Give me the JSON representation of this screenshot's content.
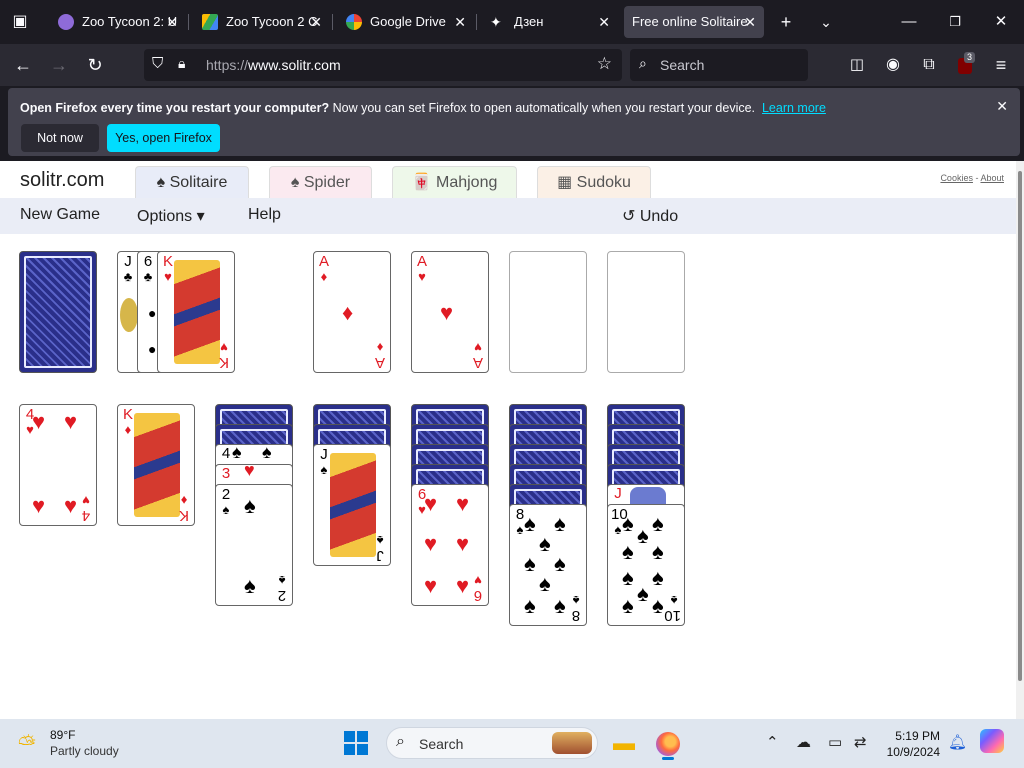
{
  "browser": {
    "tabs": [
      {
        "title": "Zoo Tycoon 2: U",
        "favicon_color": "#8e6bd8"
      },
      {
        "title": "Zoo Tycoon 2 C",
        "favicon_color": "#34a853"
      },
      {
        "title": "Google Drive",
        "favicon_color": "#4285f4"
      },
      {
        "title": "Дзен",
        "favicon_color": "#ffffff"
      },
      {
        "title": "Free online Solitaire",
        "favicon_color": ""
      }
    ],
    "url_proto": "https://",
    "url_host": "www.solitr.com",
    "search_placeholder": "Search",
    "extensions_badge": "3"
  },
  "notification": {
    "bold": "Open Firefox every time you restart your computer?",
    "text": " Now you can set Firefox to open automatically when you restart your device.",
    "link": "Learn more",
    "btn_not_now": "Not now",
    "btn_yes": "Yes, open Firefox"
  },
  "site": {
    "logo": "solitr.com",
    "game_tabs": [
      {
        "label": "♠ Solitaire",
        "bg": "#e8ecf8"
      },
      {
        "label": "♠ Spider",
        "bg": "#fbeaf0"
      },
      {
        "label": "🀄 Mahjong",
        "bg": "#eef8ea"
      },
      {
        "label": "▦ Sudoku",
        "bg": "#fbf0e6"
      }
    ],
    "link_cookies": "Cookies",
    "link_sep": " - ",
    "link_about": "About",
    "menu": {
      "new_game": "New Game",
      "options": "Options ▾",
      "help": "Help",
      "undo": "↺ Undo"
    }
  },
  "game": {
    "waste": [
      {
        "rank": "J",
        "suit": "♣"
      },
      {
        "rank": "6",
        "suit": "♣"
      },
      {
        "rank": "K",
        "suit": "♥"
      }
    ],
    "foundations": [
      {
        "rank": "A",
        "suit": "♦"
      },
      {
        "rank": "A",
        "suit": "♥"
      }
    ],
    "tableau": [
      {
        "rank": "4",
        "suit": "♥"
      },
      {
        "rank": "K",
        "suit": "♦"
      },
      {
        "peek": [
          {
            "rank": "4",
            "suit": "♠"
          },
          {
            "rank": "3",
            "suit": "♥"
          }
        ],
        "rank": "2",
        "suit": "♠"
      },
      {
        "rank": "J",
        "suit": "♠"
      },
      {
        "rank": "6",
        "suit": "♥"
      },
      {
        "rank": "8",
        "suit": "♠"
      },
      {
        "peek": [
          {
            "rank": "J",
            "suit": "♥"
          }
        ],
        "rank": "10",
        "suit": "♠"
      }
    ]
  },
  "taskbar": {
    "temp": "89°F",
    "condition": "Partly cloudy",
    "search_label": "Search",
    "time": "5:19 PM",
    "date": "10/9/2024"
  }
}
